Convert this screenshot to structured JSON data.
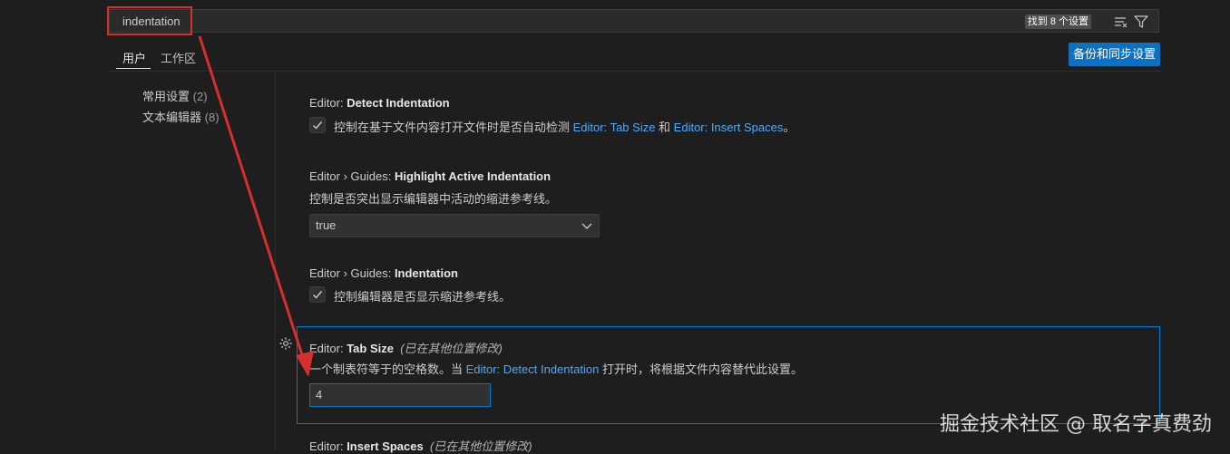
{
  "search": {
    "value": "indentation",
    "result_count": "找到 8 个设置",
    "icons": [
      "clear-filter-icon",
      "filter-icon"
    ]
  },
  "tabs": [
    {
      "label": "用户",
      "active": true
    },
    {
      "label": "工作区",
      "active": false
    }
  ],
  "backup_button": "备份和同步设置",
  "toc": [
    {
      "label": "常用设置",
      "count": "(2)"
    },
    {
      "label": "文本编辑器",
      "count": "(8)"
    }
  ],
  "settings": {
    "detect_indentation": {
      "prefix": "Editor: ",
      "name": "Detect Indentation",
      "checked": true,
      "desc_before": "控制在基于文件内容打开文件时是否自动检测 ",
      "link1": "Editor: Tab Size",
      "mid": " 和 ",
      "link2": "Editor: Insert Spaces",
      "desc_after": "。"
    },
    "highlight_active_indentation": {
      "prefix": "Editor › Guides: ",
      "name": "Highlight Active Indentation",
      "description": "控制是否突出显示编辑器中活动的缩进参考线。",
      "value": "true"
    },
    "guides_indentation": {
      "prefix": "Editor › Guides: ",
      "name": "Indentation",
      "checked": true,
      "description": "控制编辑器是否显示缩进参考线。"
    },
    "tab_size": {
      "prefix": "Editor: ",
      "name": "Tab Size",
      "modified_note": "(已在其他位置修改)",
      "desc_before": "一个制表符等于的空格数。当 ",
      "link": "Editor: Detect Indentation",
      "desc_after": " 打开时，将根据文件内容替代此设置。",
      "value": "4"
    },
    "insert_spaces": {
      "prefix": "Editor: ",
      "name": "Insert Spaces",
      "modified_note": "(已在其他位置修改)"
    }
  },
  "colors": {
    "background": "#1e1e1e",
    "accent": "#0078d4",
    "button": "#0e70c0",
    "link": "#4daafc",
    "annotation": "#d62f2f"
  },
  "watermark": "掘金技术社区 @ 取名字真费劲"
}
